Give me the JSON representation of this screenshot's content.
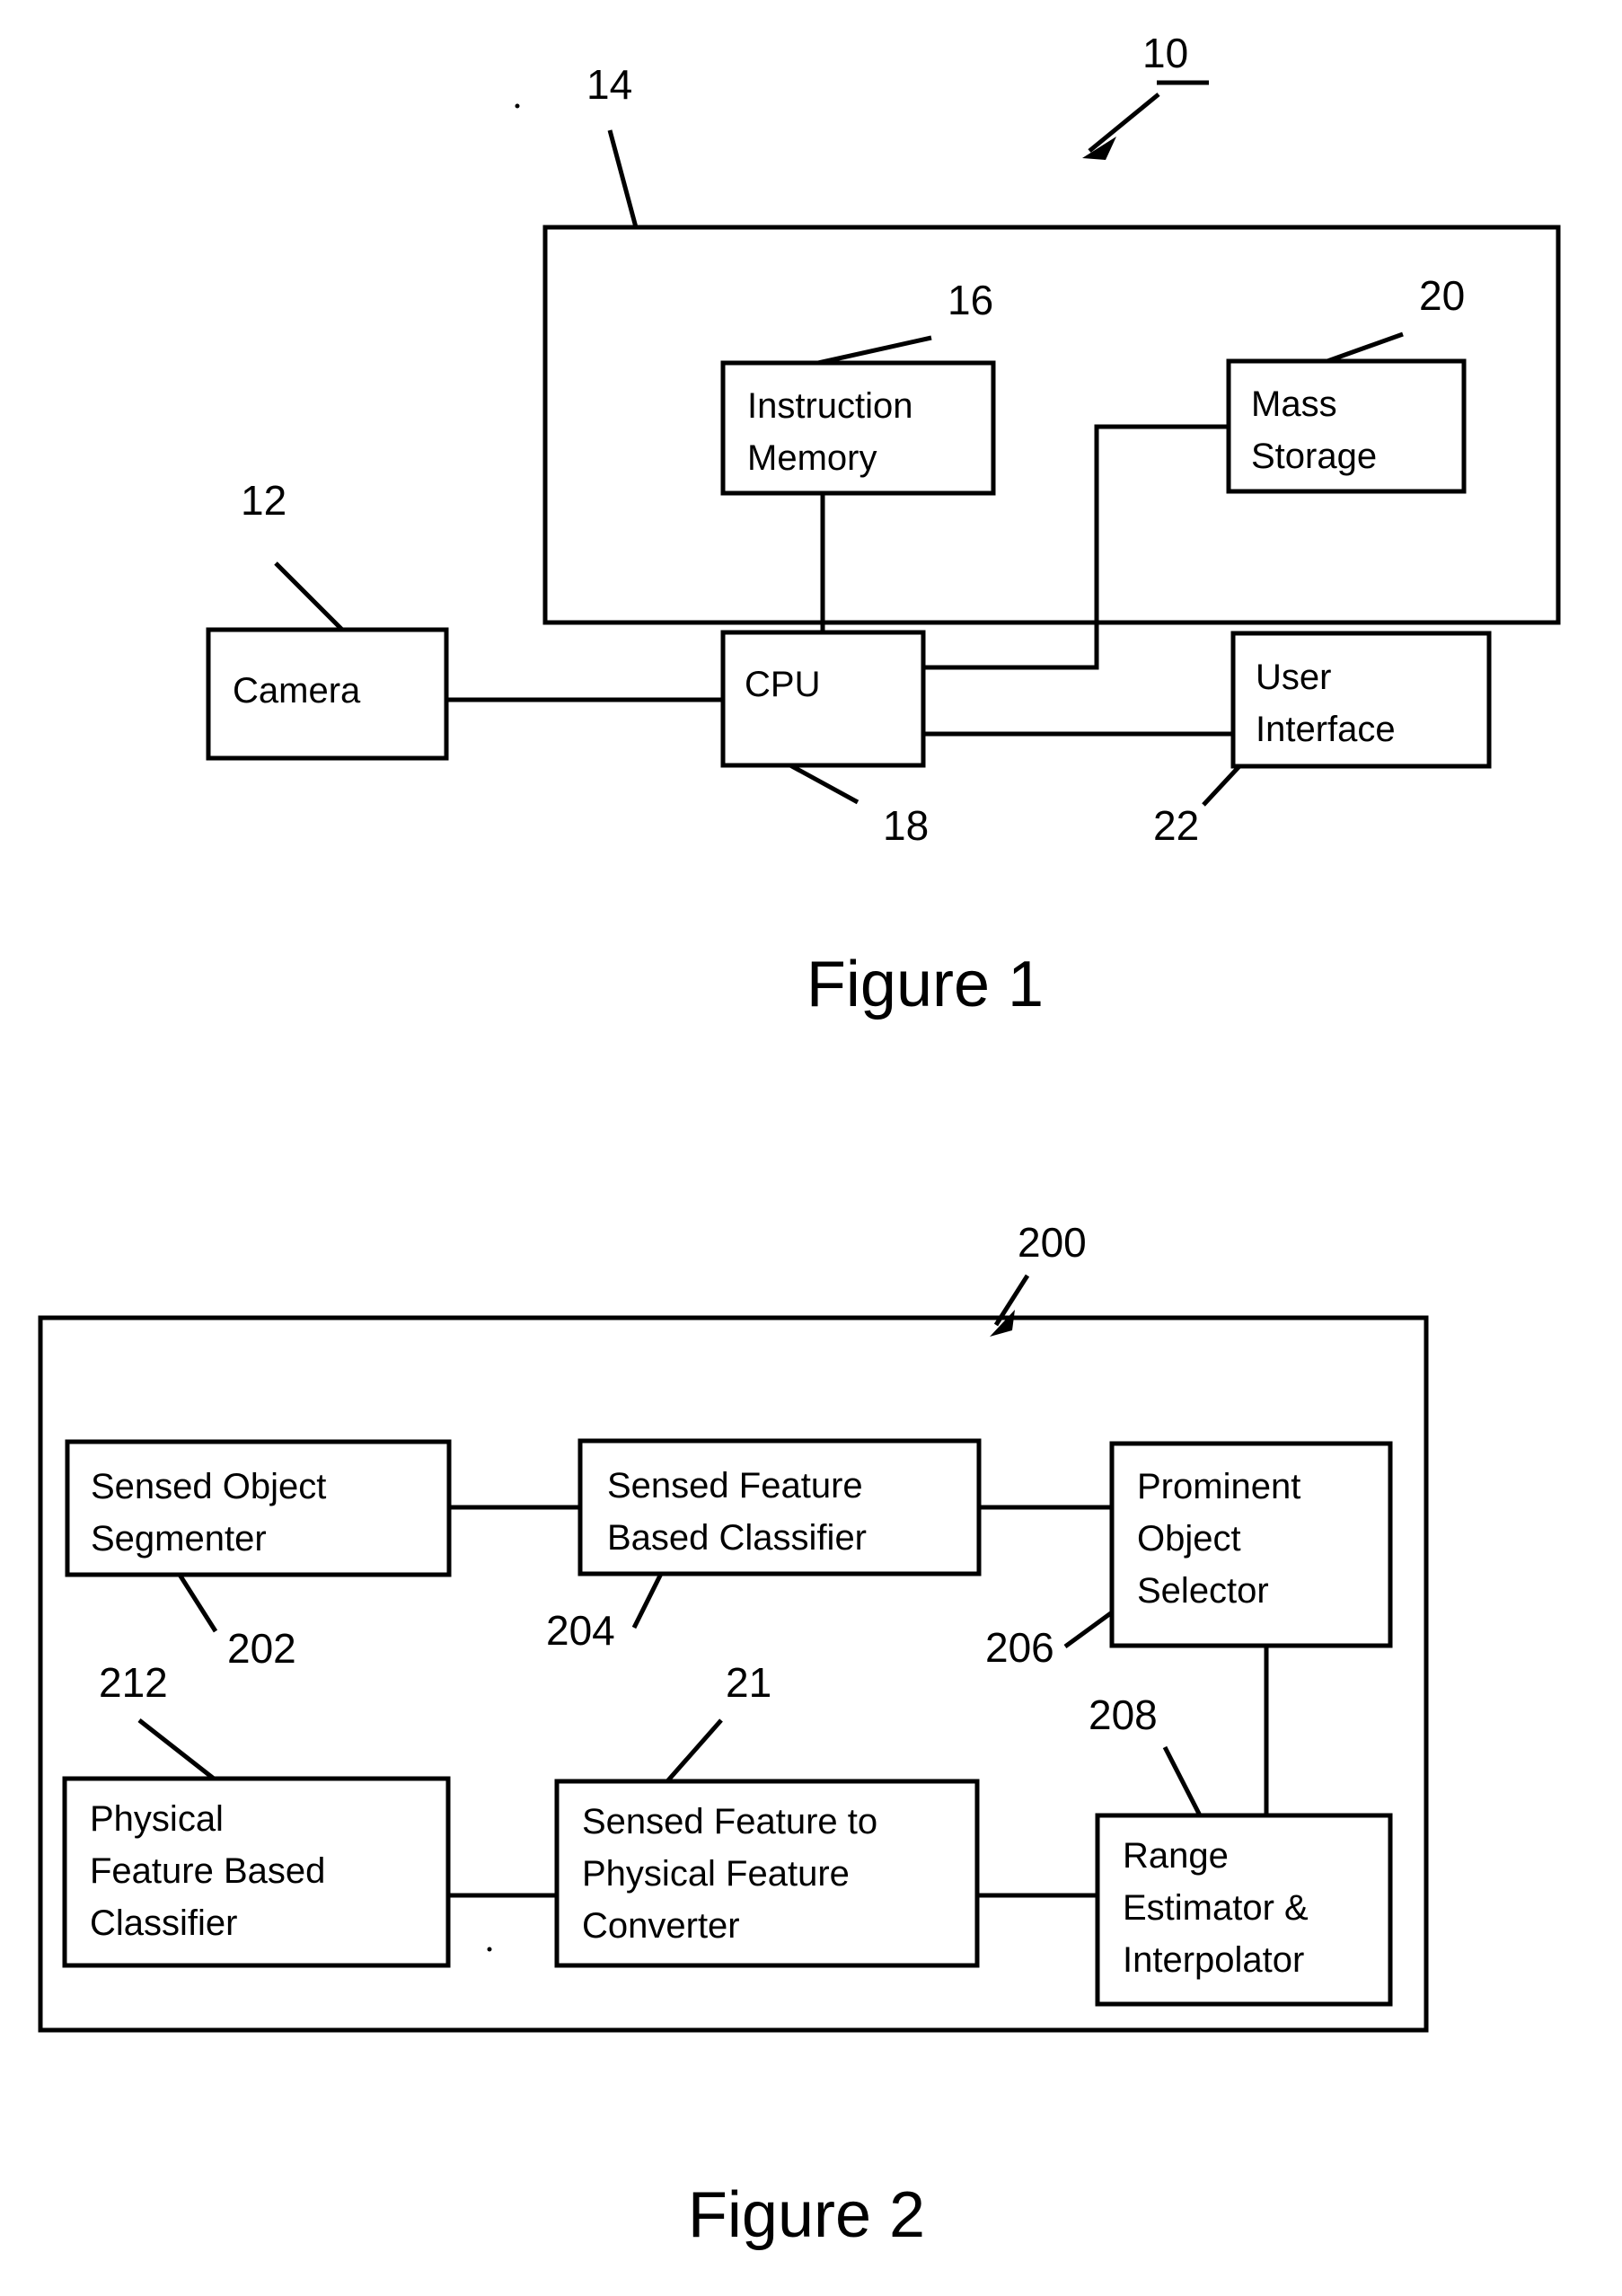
{
  "document": {
    "type": "patent-drawing-sheet",
    "background_color": "#ffffff",
    "line_color": "#000000"
  },
  "figure1": {
    "caption": "Figure 1",
    "system_ref": "10",
    "enclosure_ref": "14",
    "boxes": [
      {
        "id": "camera",
        "label_line1": "Camera",
        "label_line2": "",
        "ref": "12"
      },
      {
        "id": "instruction-memory",
        "label_line1": "Instruction",
        "label_line2": "Memory",
        "ref": "16"
      },
      {
        "id": "mass-storage",
        "label_line1": "Mass",
        "label_line2": "Storage",
        "ref": "20"
      },
      {
        "id": "cpu",
        "label_line1": "CPU",
        "label_line2": "",
        "ref": "18"
      },
      {
        "id": "user-interface",
        "label_line1": "User",
        "label_line2": "Interface",
        "ref": "22"
      }
    ],
    "connections": [
      {
        "from": "camera",
        "to": "cpu"
      },
      {
        "from": "cpu",
        "to": "instruction-memory"
      },
      {
        "from": "cpu",
        "to": "mass-storage"
      },
      {
        "from": "cpu",
        "to": "user-interface"
      }
    ]
  },
  "figure2": {
    "caption": "Figure 2",
    "system_ref": "200",
    "boxes": [
      {
        "id": "sensed-object-segmenter",
        "lines": [
          "Sensed Object",
          "Segmenter"
        ],
        "ref": "202"
      },
      {
        "id": "sensed-feature-based-classifier",
        "lines": [
          "Sensed Feature",
          "Based Classifier"
        ],
        "ref": "204"
      },
      {
        "id": "prominent-object-selector",
        "lines": [
          "Prominent",
          "Object",
          "Selector"
        ],
        "ref": "206"
      },
      {
        "id": "physical-feature-based-classifier",
        "lines": [
          "Physical",
          "Feature Based",
          "Classifier"
        ],
        "ref": "212"
      },
      {
        "id": "sensed-feature-to-physical-feature-converter",
        "lines": [
          "Sensed Feature to",
          "Physical Feature",
          "Converter"
        ],
        "ref": "21"
      },
      {
        "id": "range-estimator-interpolator",
        "lines": [
          "Range",
          "Estimator &",
          "Interpolator"
        ],
        "ref": "208"
      }
    ],
    "connections": [
      {
        "from": "sensed-object-segmenter",
        "to": "sensed-feature-based-classifier"
      },
      {
        "from": "sensed-feature-based-classifier",
        "to": "prominent-object-selector"
      },
      {
        "from": "prominent-object-selector",
        "to": "range-estimator-interpolator"
      },
      {
        "from": "range-estimator-interpolator",
        "to": "sensed-feature-to-physical-feature-converter"
      },
      {
        "from": "sensed-feature-to-physical-feature-converter",
        "to": "physical-feature-based-classifier"
      }
    ]
  }
}
